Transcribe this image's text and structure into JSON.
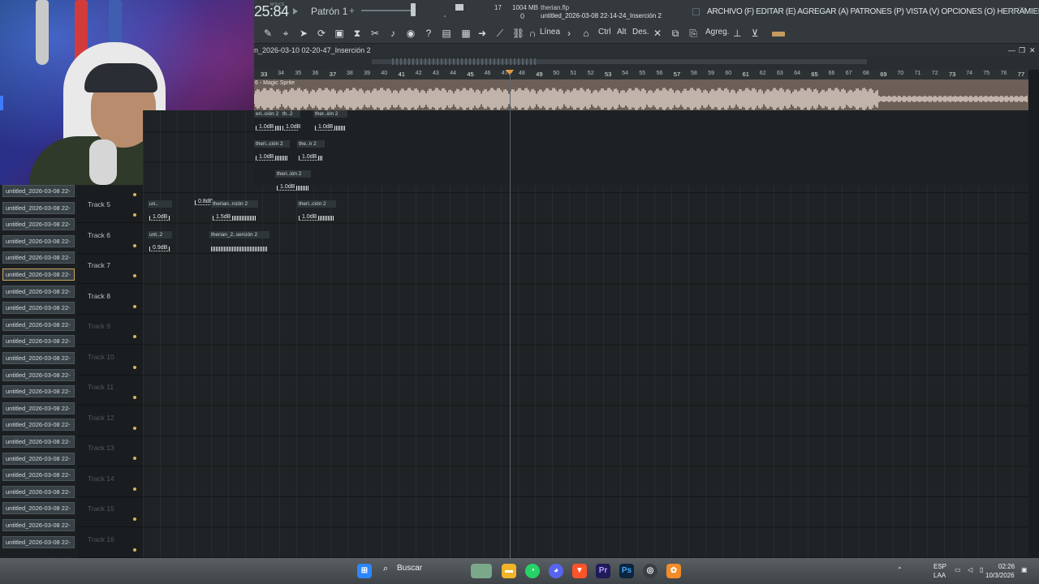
{
  "transport": {
    "time": "25:84",
    "time_small": "M:S:CS",
    "pattern": "Patrón 1",
    "plus": "+",
    "cpu": "17",
    "cpu_zero": "0",
    "memory": "1004 MB",
    "project_file": "therian.flp",
    "project_title": "untitled_2026-03-08 22-14-24_Inserción 2"
  },
  "menu": "ARCHIVO (F) EDITAR (E) AGREGAR (A) PATRONES (P) VISTA (V) OPCIONES (O) HERRAMIENTAS (T) AYUDA",
  "toolbar": {
    "snap_label": "Línea",
    "ctrl": "Ctrl",
    "alt": "Alt",
    "des": "Des.",
    "agreg": "Agreg."
  },
  "playlist": {
    "title": "n_2026-03-10 02-20-47_Inserción 2",
    "audio_clip_label": "6 - Magic Sprite",
    "ruler": [
      "33",
      "34",
      "35",
      "36",
      "37",
      "38",
      "39",
      "40",
      "41",
      "42",
      "43",
      "44",
      "45",
      "46",
      "47",
      "48",
      "49",
      "50",
      "51",
      "52",
      "53",
      "54",
      "55",
      "56",
      "57",
      "58",
      "59",
      "60",
      "61",
      "62",
      "63",
      "64",
      "65",
      "66",
      "67",
      "68",
      "69",
      "70",
      "71",
      "72",
      "73",
      "74",
      "75",
      "76",
      "77"
    ],
    "tracks": [
      "Track 5",
      "Track 6",
      "Track 7",
      "Track 8",
      "Track 9",
      "Track 10",
      "Track 11",
      "Track 12",
      "Track 13",
      "Track 14",
      "Track 15",
      "Track 16"
    ],
    "browser_items": [
      "untitled_2026-03-08 22-",
      "untitled_2026-03-08 22-",
      "untitled_2026-03-08 22-",
      "untitled_2026-03-08 22-",
      "untitled_2026-03-08 22-",
      "untitled_2026-03-08 22-",
      "untitled_2026-03-08 22-",
      "untitled_2026-03-08 22-",
      "untitled_2026-03-08 22-",
      "untitled_2026-03-08 22-",
      "untitled_2026-03-08 22-",
      "untitled_2026-03-08 22-",
      "untitled_2026-03-08 22-",
      "untitled_2026-03-08 22-",
      "untitled_2026-03-08 22-",
      "untitled_2026-03-08 22-",
      "untitled_2026-03-08 22-",
      "untitled_2026-03-08 22-",
      "untitled_2026-03-08 22-",
      "untitled_2026-03-08 22-",
      "untitled_2026-03-08 22-",
      "untitled_2026-03-08 22-"
    ],
    "clips": [
      {
        "name": "eri..ción 2",
        "gain": "1.0dB"
      },
      {
        "name": "th..2",
        "gain": "1.0dB"
      },
      {
        "name": "ther..ión 2",
        "gain": "1.0dB"
      },
      {
        "name": "theri..ción 2",
        "gain": "1.0dB"
      },
      {
        "name": "the..n 2",
        "gain": "1.0dB"
      },
      {
        "name": "theri..ión 2",
        "gain": "1.0dB"
      },
      {
        "name": "",
        "gain": "0.8dB"
      },
      {
        "name": "un..",
        "gain": "1.0dB"
      },
      {
        "name": "therian..rción 2",
        "gain": "1.5dB"
      },
      {
        "name": "theri..ción 2",
        "gain": "1.0dB"
      },
      {
        "name": "unt..2",
        "gain": "0.9dB"
      },
      {
        "name": "therian_2..serción 2",
        "gain": ""
      }
    ]
  },
  "taskbar": {
    "search": "Buscar",
    "lang1": "ESP",
    "lang2": "LAA",
    "clock_time": "02:26",
    "clock_date": "10/3/2026"
  }
}
